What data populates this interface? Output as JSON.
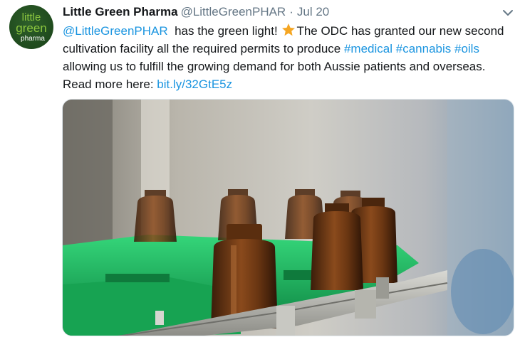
{
  "tweet": {
    "author_name": "Little Green Pharma",
    "author_handle": "@LittleGreenPHAR",
    "separator": "·",
    "date": "Jul 20",
    "avatar_text": {
      "line1": "little",
      "line2": "green",
      "line3": "pharma"
    },
    "text": {
      "mention": "@LittleGreenPHAR",
      "part1": "  has the green light! ",
      "part2": "The ODC has granted our new second cultivation facility all the required permits to produce ",
      "tag_medical": "#medical",
      "tag_cannabis": "#cannabis",
      "tag_oils": "#oils",
      "part3": " allowing us to fulfill the growing demand for both Aussie patients and overseas. Read more here: ",
      "url": "bit.ly/32GtE5z"
    },
    "media_description_icon": "star-emoji-icon",
    "colors": {
      "link": "#1b95e0",
      "text": "#14171a",
      "secondary": "#657786",
      "brand_green": "#1f4a1d",
      "conveyor_green": "#1fb35a"
    }
  }
}
